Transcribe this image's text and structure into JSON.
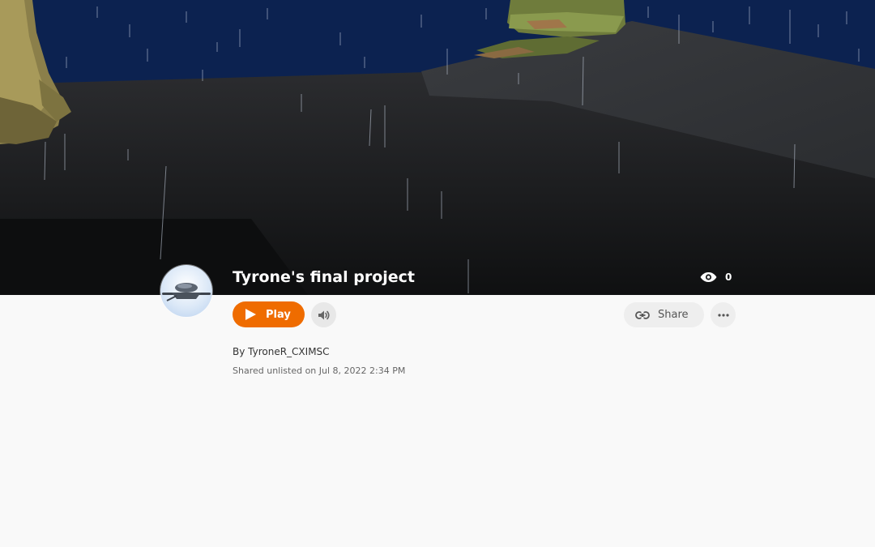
{
  "project": {
    "title": "Tyrone's final project",
    "view_count": "0",
    "author": "By TyroneR_CXIMSC",
    "shared_info": "Shared unlisted on Jul 8, 2022 2:34 PM"
  },
  "actions": {
    "play_label": "Play",
    "share_label": "Share"
  },
  "icons": {
    "views": "eye-icon",
    "play": "play-triangle-icon",
    "sound": "speaker-icon",
    "share": "link-icon",
    "more": "more-dots-icon"
  },
  "colors": {
    "accent": "#ef6c00",
    "sky": "#0c2250",
    "ground": "#1e1f22",
    "page_background": "#f9f9f9"
  }
}
